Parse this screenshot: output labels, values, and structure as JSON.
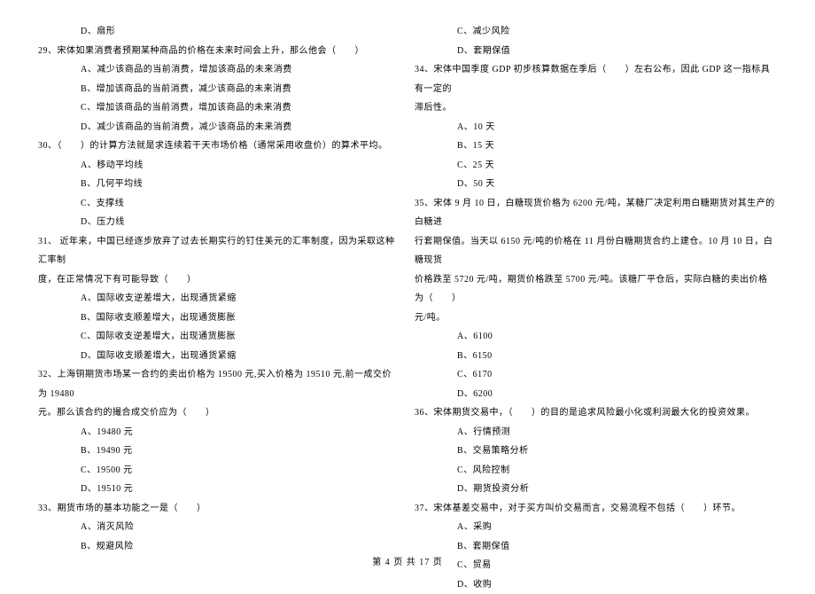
{
  "left_column": {
    "q28_opt_d": "D、扇形",
    "q29_stem": "29、宋体如果消费者预期某种商品的价格在未来时间会上升，那么他会（　　）",
    "q29_opt_a": "A、减少该商品的当前消费，增加该商品的未来消费",
    "q29_opt_b": "B、增加该商品的当前消费，减少该商品的未来消费",
    "q29_opt_c": "C、增加该商品的当前消费，增加该商品的未来消费",
    "q29_opt_d": "D、减少该商品的当前消费，减少该商品的未来消费",
    "q30_stem": "30、（　　）的计算方法就是求连续若干天市场价格（通常采用收盘价）的算术平均。",
    "q30_opt_a": "A、移动平均线",
    "q30_opt_b": "B、几何平均线",
    "q30_opt_c": "C、支撑线",
    "q30_opt_d": "D、压力线",
    "q31_stem_l1": "31、 近年来，中国已经逐步放弃了过去长期实行的钉住美元的汇率制度，因为采取这种汇率制",
    "q31_stem_l2": "度，在正常情况下有可能导致（　　）",
    "q31_opt_a": "A、国际收支逆差增大，出现通货紧缩",
    "q31_opt_b": "B、国际收支顺差增大，出现通货膨胀",
    "q31_opt_c": "C、国际收支逆差增大，出现通货膨胀",
    "q31_opt_d": "D、国际收支顺差增大，出现通货紧缩",
    "q32_stem_l1": "32、上海铜期货市场某一合约的卖出价格为 19500 元,买入价格为 19510 元,前一成交价为 19480",
    "q32_stem_l2": "元。那么该合约的撮合成交价应为（　　）",
    "q32_opt_a": "A、19480 元",
    "q32_opt_b": "B、19490 元",
    "q32_opt_c": "C、19500 元",
    "q32_opt_d": "D、19510 元",
    "q33_stem": "33、期货市场的基本功能之一是（　　）",
    "q33_opt_a": "A、消灭风险",
    "q33_opt_b": "B、规避风险"
  },
  "right_column": {
    "q33_opt_c": "C、减少风险",
    "q33_opt_d": "D、套期保值",
    "q34_stem_l1": "34、宋体中国季度 GDP 初步核算数据在季后（　　）左右公布，因此 GDP 这一指标具有一定的",
    "q34_stem_l2": "滞后性。",
    "q34_opt_a": "A、10 天",
    "q34_opt_b": "B、15 天",
    "q34_opt_c": "C、25 天",
    "q34_opt_d": "D、50 天",
    "q35_stem_l1": "35、宋体 9 月 10 日，白糖现货价格为 6200 元/吨，某糖厂决定利用白糖期货对其生产的白糖进",
    "q35_stem_l2": "行套期保值。当天以 6150 元/吨的价格在 11 月份白糖期货合约上建仓。10 月 10 日，白糖现货",
    "q35_stem_l3": "价格跌至 5720 元/吨，期货价格跌至 5700 元/吨。该糖厂平仓后，实际白糖的卖出价格为（　　）",
    "q35_stem_l4": "元/吨。",
    "q35_opt_a": "A、6100",
    "q35_opt_b": "B、6150",
    "q35_opt_c": "C、6170",
    "q35_opt_d": "D、6200",
    "q36_stem": "36、宋体期货交易中，（　　）的目的是追求风险最小化或利润最大化的投资效果。",
    "q36_opt_a": "A、行情预测",
    "q36_opt_b": "B、交易策略分析",
    "q36_opt_c": "C、风险控制",
    "q36_opt_d": "D、期货投资分析",
    "q37_stem": "37、宋体基差交易中，对于买方叫价交易而言，交易流程不包括（　　）环节。",
    "q37_opt_a": "A、采购",
    "q37_opt_b": "B、套期保值",
    "q37_opt_c": "C、贸易",
    "q37_opt_d": "D、收购"
  },
  "footer": "第 4 页 共 17 页"
}
